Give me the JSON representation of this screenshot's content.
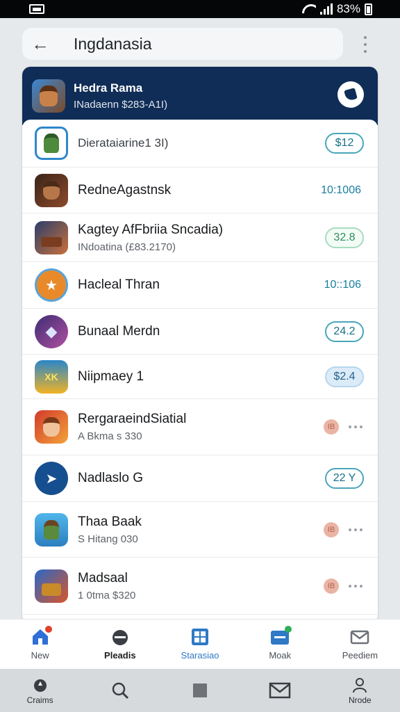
{
  "status_bar": {
    "battery_text": "83%"
  },
  "title_bar": {
    "title": "Ingdanasia"
  },
  "header": {
    "title": "Hedra Rama",
    "subtitle": "INadaenn $283-A1I)"
  },
  "featured": {
    "name": "Dierataiarine1 3I)",
    "badge": "$12"
  },
  "apps": [
    {
      "name": "RedneAgastnsk",
      "sub": "",
      "value": "10:1006",
      "kind": "text"
    },
    {
      "name": "Kagtey AfFbriia Sncadia)",
      "sub": "INdoatina (£83.2170)",
      "value": "32.8",
      "kind": "pill-green"
    },
    {
      "name": "Hacleal Thran",
      "sub": "",
      "value": "10::106",
      "kind": "text"
    },
    {
      "name": "Bunaal Merdn",
      "sub": "",
      "value": "24.2",
      "kind": "pill"
    },
    {
      "name": "Niipmaey 1",
      "sub": "",
      "value": "$2.4",
      "kind": "pill-filled"
    },
    {
      "name": "RergaraeindSiatial",
      "sub": "A Bkma s 330",
      "value": "IB",
      "kind": "more"
    },
    {
      "name": "Nadlaslo G",
      "sub": "",
      "value": "22 Y",
      "kind": "pill"
    },
    {
      "name": "Thaa Baak",
      "sub": "S Hitang 030",
      "value": "IB",
      "kind": "more"
    },
    {
      "name": "Madsaal",
      "sub": "1 0tma $320",
      "value": "IB",
      "kind": "more"
    }
  ],
  "tabs": [
    {
      "label": "New",
      "icon": "home-icon",
      "color": "#2f6fd6"
    },
    {
      "label": "Pleadis",
      "icon": "gauge-icon",
      "color": "#3a3f45"
    },
    {
      "label": "Starasiao",
      "icon": "grid-icon",
      "color": "#2f79c6"
    },
    {
      "label": "Moak",
      "icon": "inbox-icon",
      "color": "#2f79c6"
    },
    {
      "label": "Peediem",
      "icon": "mail-check-icon",
      "color": "#6b7178"
    }
  ],
  "nav": [
    {
      "label": "Craims",
      "icon": "drop-icon"
    },
    {
      "label": "",
      "icon": "search-icon"
    },
    {
      "label": "",
      "icon": "square-icon"
    },
    {
      "label": "",
      "icon": "mail-icon"
    },
    {
      "label": "Nrode",
      "icon": "person-icon"
    }
  ]
}
